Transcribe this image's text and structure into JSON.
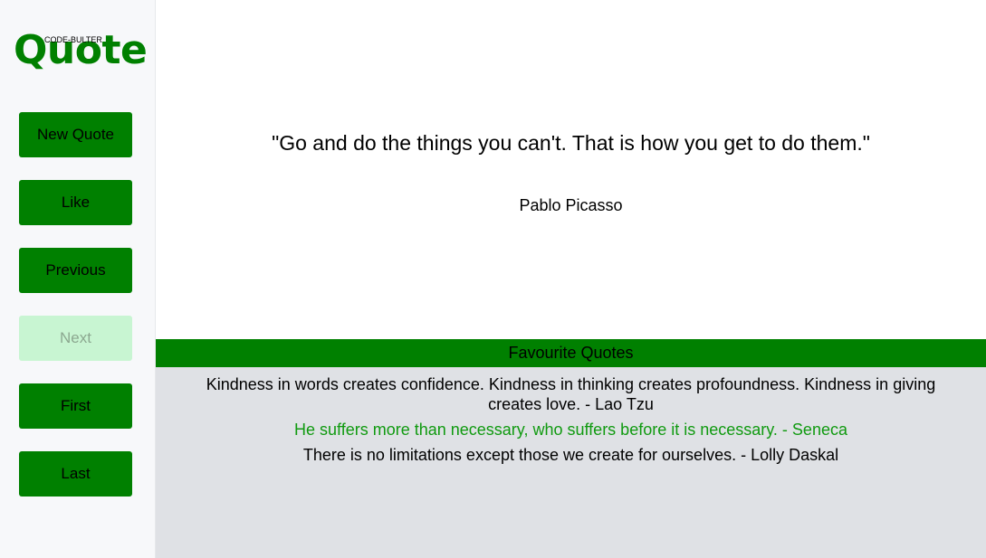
{
  "logo": {
    "main": "Quote",
    "small": "CODE-BULTER"
  },
  "nav": {
    "new_quote": "New Quote",
    "like": "Like",
    "previous": "Previous",
    "next": "Next",
    "first": "First",
    "last": "Last"
  },
  "quote": {
    "text": "\"Go and do the things you can't. That is how you get to do them.\"",
    "author": "Pablo Picasso"
  },
  "favourites": {
    "title": "Favourite Quotes",
    "items": [
      "Kindness in words creates confidence. Kindness in thinking creates profoundness. Kindness in giving creates love. - Lao Tzu",
      "He suffers more than necessary, who suffers before it is necessary. - Seneca",
      "There is no limitations except those we create for ourselves. - Lolly Daskal"
    ]
  },
  "colors": {
    "accent": "#008000",
    "button_disabled": "#c8f5d2",
    "favourites_bg": "#dfe1e5",
    "highlighted_favourite": "#109a10"
  }
}
